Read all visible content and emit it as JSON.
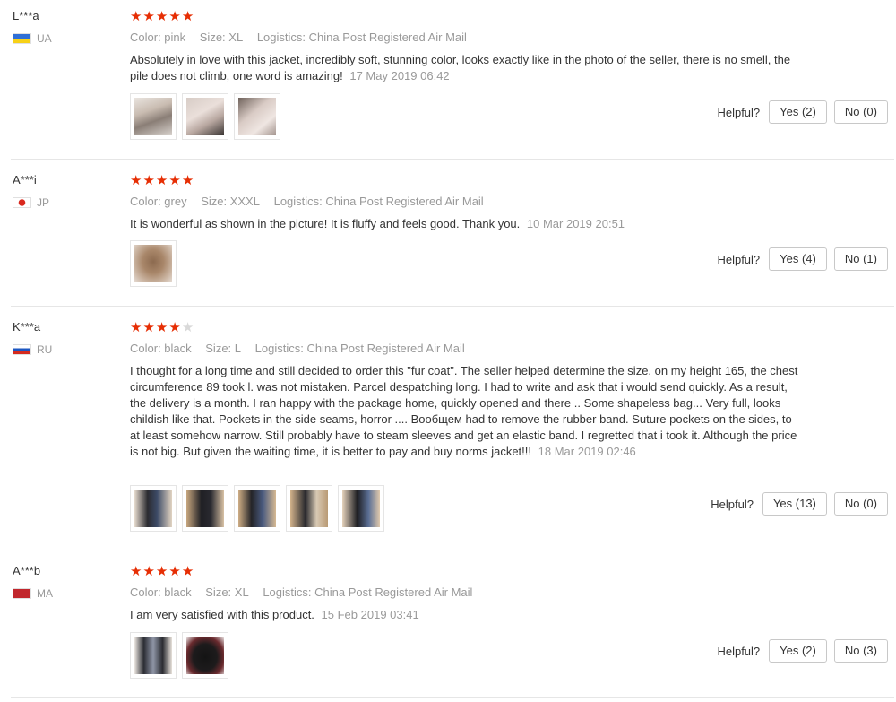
{
  "reviews": [
    {
      "user": "L***a",
      "country": "UA",
      "rating": 5,
      "color_label": "Color: pink",
      "size_label": "Size: XL",
      "logistics_label": "Logistics: China Post Registered Air Mail",
      "text": "Absolutely in love with this jacket, incredibly soft, stunning color, looks exactly like in the photo of the seller, there is no smell, the pile does not climb, one word is amazing!",
      "date": "17 May 2019 06:42",
      "helpful_label": "Helpful?",
      "yes_label": "Yes (2)",
      "no_label": "No (0)"
    },
    {
      "user": "A***i",
      "country": "JP",
      "rating": 5,
      "color_label": "Color: grey",
      "size_label": "Size: XXXL",
      "logistics_label": "Logistics: China Post Registered Air Mail",
      "text": "It is wonderful as shown in the picture! It is fluffy and feels good. Thank you.",
      "date": "10 Mar 2019 20:51",
      "helpful_label": "Helpful?",
      "yes_label": "Yes (4)",
      "no_label": "No (1)"
    },
    {
      "user": "K***a",
      "country": "RU",
      "rating": 4,
      "color_label": "Color: black",
      "size_label": "Size: L",
      "logistics_label": "Logistics: China Post Registered Air Mail",
      "text": "I thought for a long time and still decided to order this \"fur coat\". The seller helped determine the size. on my height 165, the chest circumference 89 took l. was not mistaken. Parcel despatching long. I had to write and ask that i would send quickly. As a result, the delivery is a month. I ran happy with the package home, quickly opened and there .. Some shapeless bag... Very full, looks childish like that. Pockets in the side seams, horror .... Вообщем had to remove the rubber band. Suture pockets on the sides, to at least somehow narrow. Still probably have to steam sleeves and get an elastic band. I regretted that i took it. Although the price is not big. But given the waiting time, it is better to pay and buy norms jacket!!!",
      "date": "18 Mar 2019 02:46",
      "helpful_label": "Helpful?",
      "yes_label": "Yes (13)",
      "no_label": "No (0)"
    },
    {
      "user": "A***b",
      "country": "MA",
      "rating": 5,
      "color_label": "Color: black",
      "size_label": "Size: XL",
      "logistics_label": "Logistics: China Post Registered Air Mail",
      "text": "I am very satisfied with this product.",
      "date": "15 Feb 2019 03:41",
      "helpful_label": "Helpful?",
      "yes_label": "Yes (2)",
      "no_label": "No (3)"
    }
  ],
  "colors": {
    "star": "#e62e04",
    "star_off": "#d9d9d9",
    "muted_text": "#999999"
  }
}
